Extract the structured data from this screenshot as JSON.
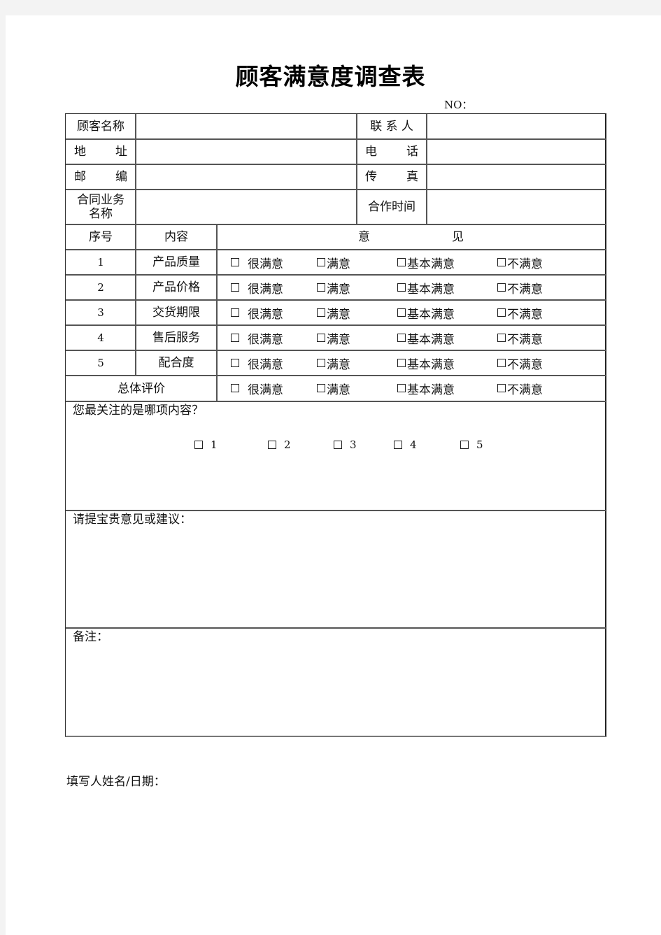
{
  "document": {
    "title": "顾客满意度调查表",
    "no_label": "NO："
  },
  "customer_info": {
    "rows": [
      {
        "left_label": "顾客名称",
        "left_value": "",
        "right_label": "联 系 人",
        "right_value": ""
      },
      {
        "left_label_parts": [
          "地",
          "址"
        ],
        "left_value": "",
        "right_label_parts": [
          "电",
          "话"
        ],
        "right_value": ""
      },
      {
        "left_label_parts": [
          "邮",
          "编"
        ],
        "left_value": "",
        "right_label_parts": [
          "传",
          "真"
        ],
        "right_value": ""
      },
      {
        "left_label_lines": [
          "合同业务",
          "名称"
        ],
        "left_value": "",
        "right_label": "合作时间",
        "right_value": ""
      }
    ]
  },
  "rating_table": {
    "header": {
      "seq": "序号",
      "content": "内容",
      "opinion_parts": [
        "意",
        "见"
      ]
    },
    "options": [
      "很满意",
      "满意",
      "基本满意",
      "不满意"
    ],
    "items": [
      {
        "seq": "1",
        "content": "产品质量"
      },
      {
        "seq": "2",
        "content": "产品价格"
      },
      {
        "seq": "3",
        "content": "交货期限"
      },
      {
        "seq": "4",
        "content": "售后服务"
      },
      {
        "seq": "5",
        "content": "配合度"
      }
    ],
    "overall_label": "总体评价"
  },
  "focus_question": {
    "label": "您最关注的是哪项内容？",
    "choices": [
      "1",
      "2",
      "3",
      "4",
      "5"
    ]
  },
  "suggestions": {
    "label": "请提宝贵意见或建议："
  },
  "remarks": {
    "label": "备注："
  },
  "footer": {
    "signer_label": "填写人姓名/日期："
  }
}
